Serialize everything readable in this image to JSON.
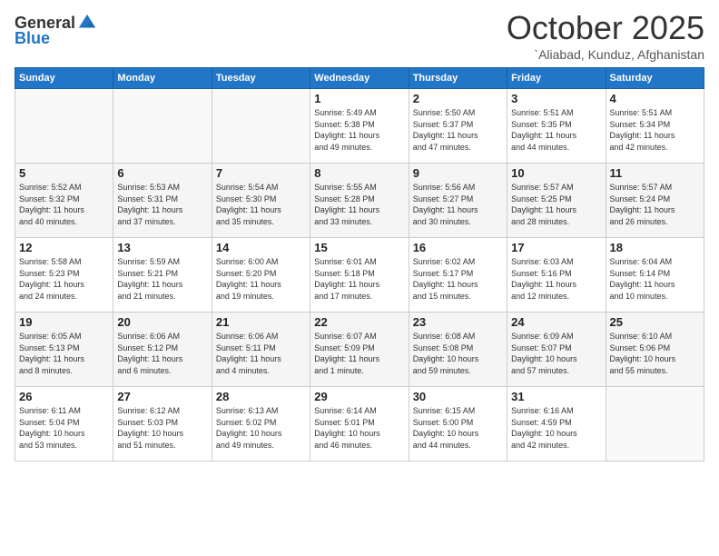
{
  "header": {
    "logo_line1": "General",
    "logo_line2": "Blue",
    "month": "October 2025",
    "location": "`Aliabad, Kunduz, Afghanistan"
  },
  "weekdays": [
    "Sunday",
    "Monday",
    "Tuesday",
    "Wednesday",
    "Thursday",
    "Friday",
    "Saturday"
  ],
  "weeks": [
    [
      {
        "day": "",
        "info": ""
      },
      {
        "day": "",
        "info": ""
      },
      {
        "day": "",
        "info": ""
      },
      {
        "day": "1",
        "info": "Sunrise: 5:49 AM\nSunset: 5:38 PM\nDaylight: 11 hours\nand 49 minutes."
      },
      {
        "day": "2",
        "info": "Sunrise: 5:50 AM\nSunset: 5:37 PM\nDaylight: 11 hours\nand 47 minutes."
      },
      {
        "day": "3",
        "info": "Sunrise: 5:51 AM\nSunset: 5:35 PM\nDaylight: 11 hours\nand 44 minutes."
      },
      {
        "day": "4",
        "info": "Sunrise: 5:51 AM\nSunset: 5:34 PM\nDaylight: 11 hours\nand 42 minutes."
      }
    ],
    [
      {
        "day": "5",
        "info": "Sunrise: 5:52 AM\nSunset: 5:32 PM\nDaylight: 11 hours\nand 40 minutes."
      },
      {
        "day": "6",
        "info": "Sunrise: 5:53 AM\nSunset: 5:31 PM\nDaylight: 11 hours\nand 37 minutes."
      },
      {
        "day": "7",
        "info": "Sunrise: 5:54 AM\nSunset: 5:30 PM\nDaylight: 11 hours\nand 35 minutes."
      },
      {
        "day": "8",
        "info": "Sunrise: 5:55 AM\nSunset: 5:28 PM\nDaylight: 11 hours\nand 33 minutes."
      },
      {
        "day": "9",
        "info": "Sunrise: 5:56 AM\nSunset: 5:27 PM\nDaylight: 11 hours\nand 30 minutes."
      },
      {
        "day": "10",
        "info": "Sunrise: 5:57 AM\nSunset: 5:25 PM\nDaylight: 11 hours\nand 28 minutes."
      },
      {
        "day": "11",
        "info": "Sunrise: 5:57 AM\nSunset: 5:24 PM\nDaylight: 11 hours\nand 26 minutes."
      }
    ],
    [
      {
        "day": "12",
        "info": "Sunrise: 5:58 AM\nSunset: 5:23 PM\nDaylight: 11 hours\nand 24 minutes."
      },
      {
        "day": "13",
        "info": "Sunrise: 5:59 AM\nSunset: 5:21 PM\nDaylight: 11 hours\nand 21 minutes."
      },
      {
        "day": "14",
        "info": "Sunrise: 6:00 AM\nSunset: 5:20 PM\nDaylight: 11 hours\nand 19 minutes."
      },
      {
        "day": "15",
        "info": "Sunrise: 6:01 AM\nSunset: 5:18 PM\nDaylight: 11 hours\nand 17 minutes."
      },
      {
        "day": "16",
        "info": "Sunrise: 6:02 AM\nSunset: 5:17 PM\nDaylight: 11 hours\nand 15 minutes."
      },
      {
        "day": "17",
        "info": "Sunrise: 6:03 AM\nSunset: 5:16 PM\nDaylight: 11 hours\nand 12 minutes."
      },
      {
        "day": "18",
        "info": "Sunrise: 6:04 AM\nSunset: 5:14 PM\nDaylight: 11 hours\nand 10 minutes."
      }
    ],
    [
      {
        "day": "19",
        "info": "Sunrise: 6:05 AM\nSunset: 5:13 PM\nDaylight: 11 hours\nand 8 minutes."
      },
      {
        "day": "20",
        "info": "Sunrise: 6:06 AM\nSunset: 5:12 PM\nDaylight: 11 hours\nand 6 minutes."
      },
      {
        "day": "21",
        "info": "Sunrise: 6:06 AM\nSunset: 5:11 PM\nDaylight: 11 hours\nand 4 minutes."
      },
      {
        "day": "22",
        "info": "Sunrise: 6:07 AM\nSunset: 5:09 PM\nDaylight: 11 hours\nand 1 minute."
      },
      {
        "day": "23",
        "info": "Sunrise: 6:08 AM\nSunset: 5:08 PM\nDaylight: 10 hours\nand 59 minutes."
      },
      {
        "day": "24",
        "info": "Sunrise: 6:09 AM\nSunset: 5:07 PM\nDaylight: 10 hours\nand 57 minutes."
      },
      {
        "day": "25",
        "info": "Sunrise: 6:10 AM\nSunset: 5:06 PM\nDaylight: 10 hours\nand 55 minutes."
      }
    ],
    [
      {
        "day": "26",
        "info": "Sunrise: 6:11 AM\nSunset: 5:04 PM\nDaylight: 10 hours\nand 53 minutes."
      },
      {
        "day": "27",
        "info": "Sunrise: 6:12 AM\nSunset: 5:03 PM\nDaylight: 10 hours\nand 51 minutes."
      },
      {
        "day": "28",
        "info": "Sunrise: 6:13 AM\nSunset: 5:02 PM\nDaylight: 10 hours\nand 49 minutes."
      },
      {
        "day": "29",
        "info": "Sunrise: 6:14 AM\nSunset: 5:01 PM\nDaylight: 10 hours\nand 46 minutes."
      },
      {
        "day": "30",
        "info": "Sunrise: 6:15 AM\nSunset: 5:00 PM\nDaylight: 10 hours\nand 44 minutes."
      },
      {
        "day": "31",
        "info": "Sunrise: 6:16 AM\nSunset: 4:59 PM\nDaylight: 10 hours\nand 42 minutes."
      },
      {
        "day": "",
        "info": ""
      }
    ]
  ]
}
